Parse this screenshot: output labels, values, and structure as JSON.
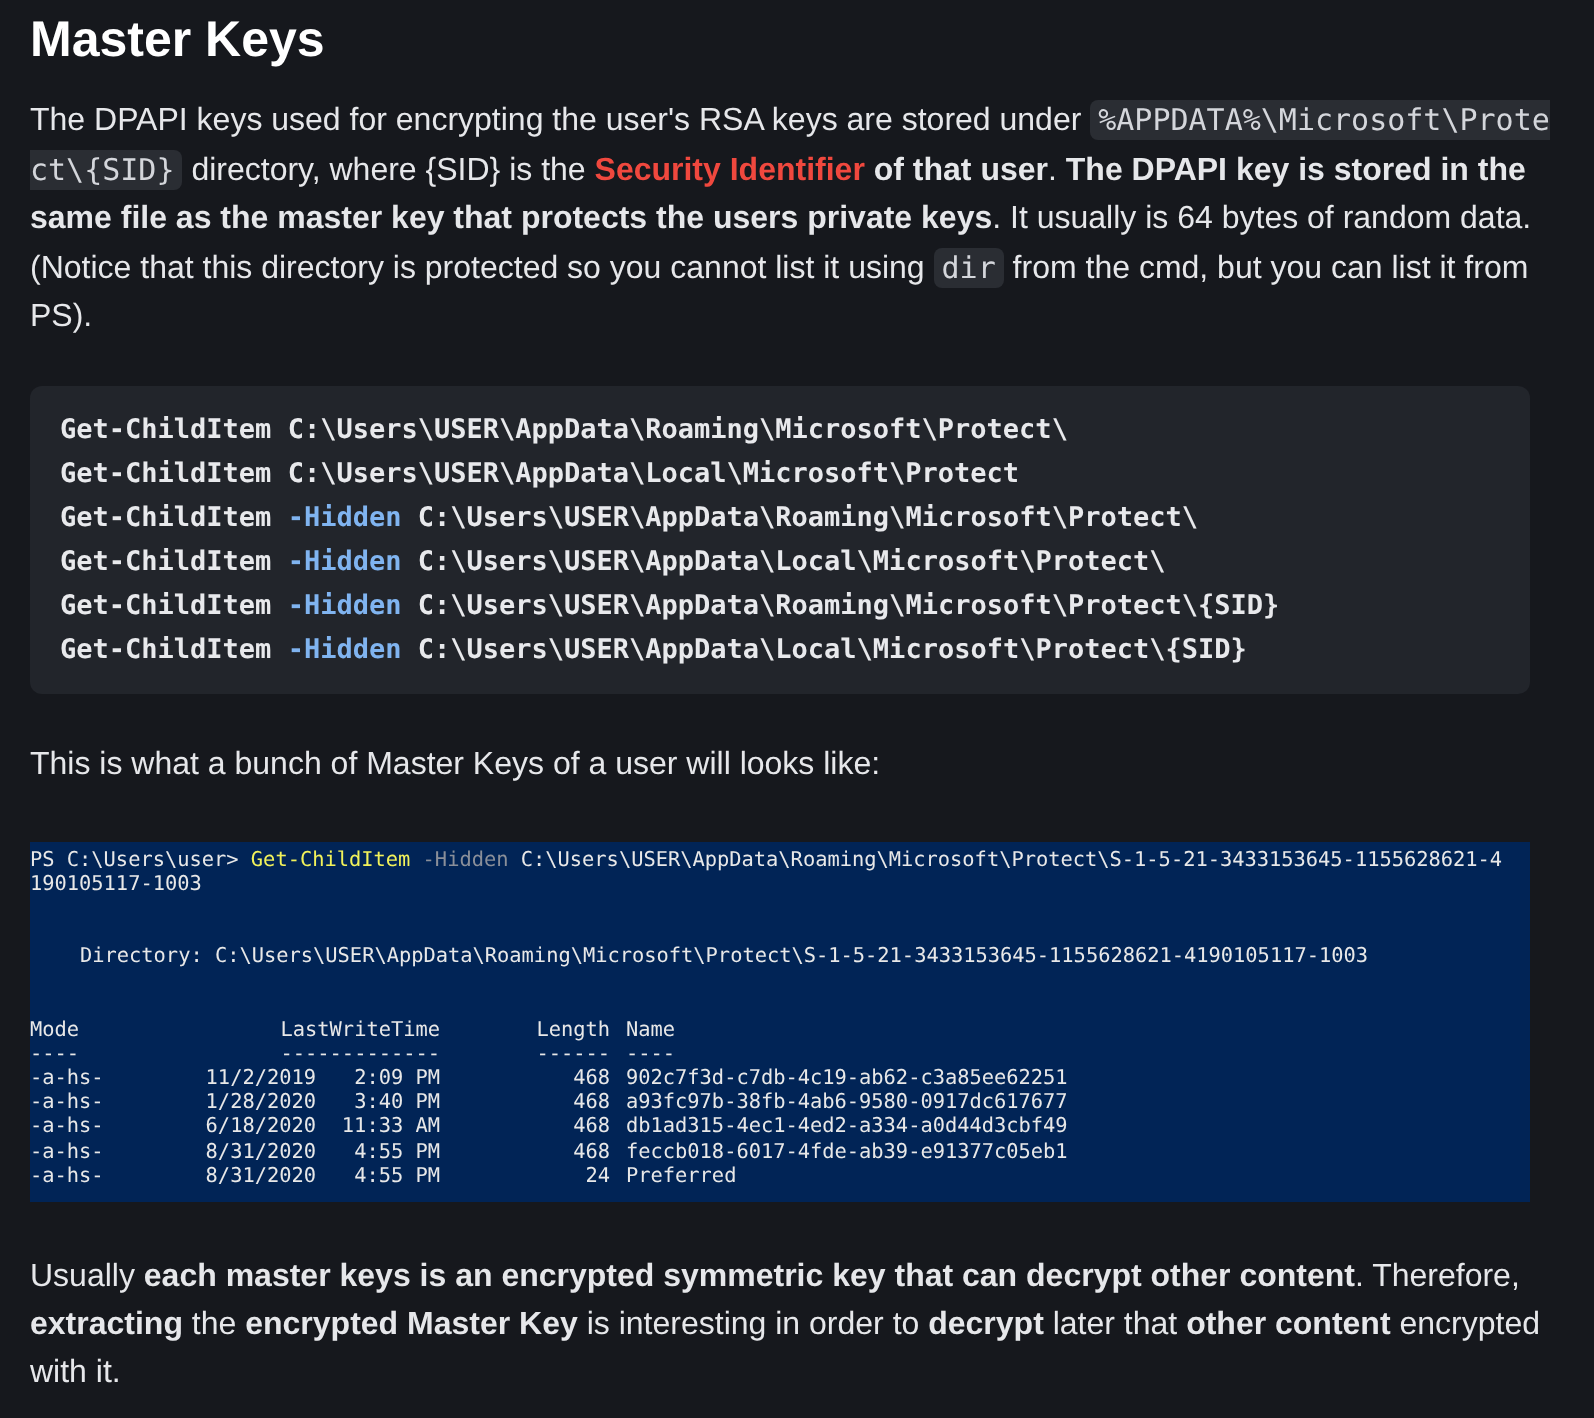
{
  "heading": "Master Keys",
  "intro": [
    {
      "kind": "text",
      "text": "The DPAPI keys used for encrypting the user's RSA keys are stored under "
    },
    {
      "kind": "code",
      "text": "%APPDATA%\\Microsoft\\Protect\\{SID}"
    },
    {
      "kind": "text",
      "text": " directory, where {SID} is the "
    },
    {
      "kind": "link",
      "text": "Security Identifier"
    },
    {
      "kind": "text",
      "text": " **of that user**. **The DPAPI key is stored in the same file as the master key that protects the users private keys**. It usually is 64 bytes of random data. (Notice that this directory is protected so you cannot list it using "
    },
    {
      "kind": "code",
      "text": "dir"
    },
    {
      "kind": "text",
      "text": " from the cmd, but you can list it from PS)."
    }
  ],
  "code_block": [
    {
      "command": "Get-ChildItem",
      "path": "C:\\Users\\USER\\AppData\\Roaming\\Microsoft\\Protect\\"
    },
    {
      "command": "Get-ChildItem",
      "path": "C:\\Users\\USER\\AppData\\Local\\Microsoft\\Protect"
    },
    {
      "command": "Get-ChildItem",
      "flag": "-Hidden",
      "path": "C:\\Users\\USER\\AppData\\Roaming\\Microsoft\\Protect\\"
    },
    {
      "command": "Get-ChildItem",
      "flag": "-Hidden",
      "path": "C:\\Users\\USER\\AppData\\Local\\Microsoft\\Protect\\"
    },
    {
      "command": "Get-ChildItem",
      "flag": "-Hidden",
      "path": "C:\\Users\\USER\\AppData\\Roaming\\Microsoft\\Protect\\{SID}"
    },
    {
      "command": "Get-ChildItem",
      "flag": "-Hidden",
      "path": "C:\\Users\\USER\\AppData\\Local\\Microsoft\\Protect\\{SID}"
    }
  ],
  "caption": "This is what a bunch of Master Keys of a user will looks like:",
  "terminal": {
    "prompt": "PS C:\\Users\\user>",
    "command": "Get-ChildItem",
    "flag": "-Hidden",
    "path": "C:\\Users\\USER\\AppData\\Roaming\\Microsoft\\Protect\\S-1-5-21-3433153645-1155628621-4",
    "path_wrap": "190105117-1003",
    "directory": "Directory: C:\\Users\\USER\\AppData\\Roaming\\Microsoft\\Protect\\S-1-5-21-3433153645-1155628621-4190105117-1003",
    "columns": [
      "Mode",
      "LastWriteTime",
      "Length",
      "Name"
    ],
    "underlines": [
      "----",
      "-------------",
      "------",
      "----"
    ],
    "rows": [
      {
        "mode": "-a-hs-",
        "date": "11/2/2019",
        "time": "2:09 PM",
        "length": "468",
        "name": "902c7f3d-c7db-4c19-ab62-c3a85ee62251"
      },
      {
        "mode": "-a-hs-",
        "date": "1/28/2020",
        "time": "3:40 PM",
        "length": "468",
        "name": "a93fc97b-38fb-4ab6-9580-0917dc617677"
      },
      {
        "mode": "-a-hs-",
        "date": "6/18/2020",
        "time": "11:33 AM",
        "length": "468",
        "name": "db1ad315-4ec1-4ed2-a334-a0d44d3cbf49"
      },
      {
        "mode": "-a-hs-",
        "date": "8/31/2020",
        "time": "4:55 PM",
        "length": "468",
        "name": "feccb018-6017-4fde-ab39-e91377c05eb1"
      },
      {
        "mode": "-a-hs-",
        "date": "8/31/2020",
        "time": "4:55 PM",
        "length": "24",
        "name": "Preferred"
      }
    ]
  },
  "outro": "Usually **each master keys is an encrypted symmetric key that can decrypt other content**. Therefore, **extracting** the **encrypted Master Key** is interesting in order to **decrypt** later that **other content** encrypted with it."
}
